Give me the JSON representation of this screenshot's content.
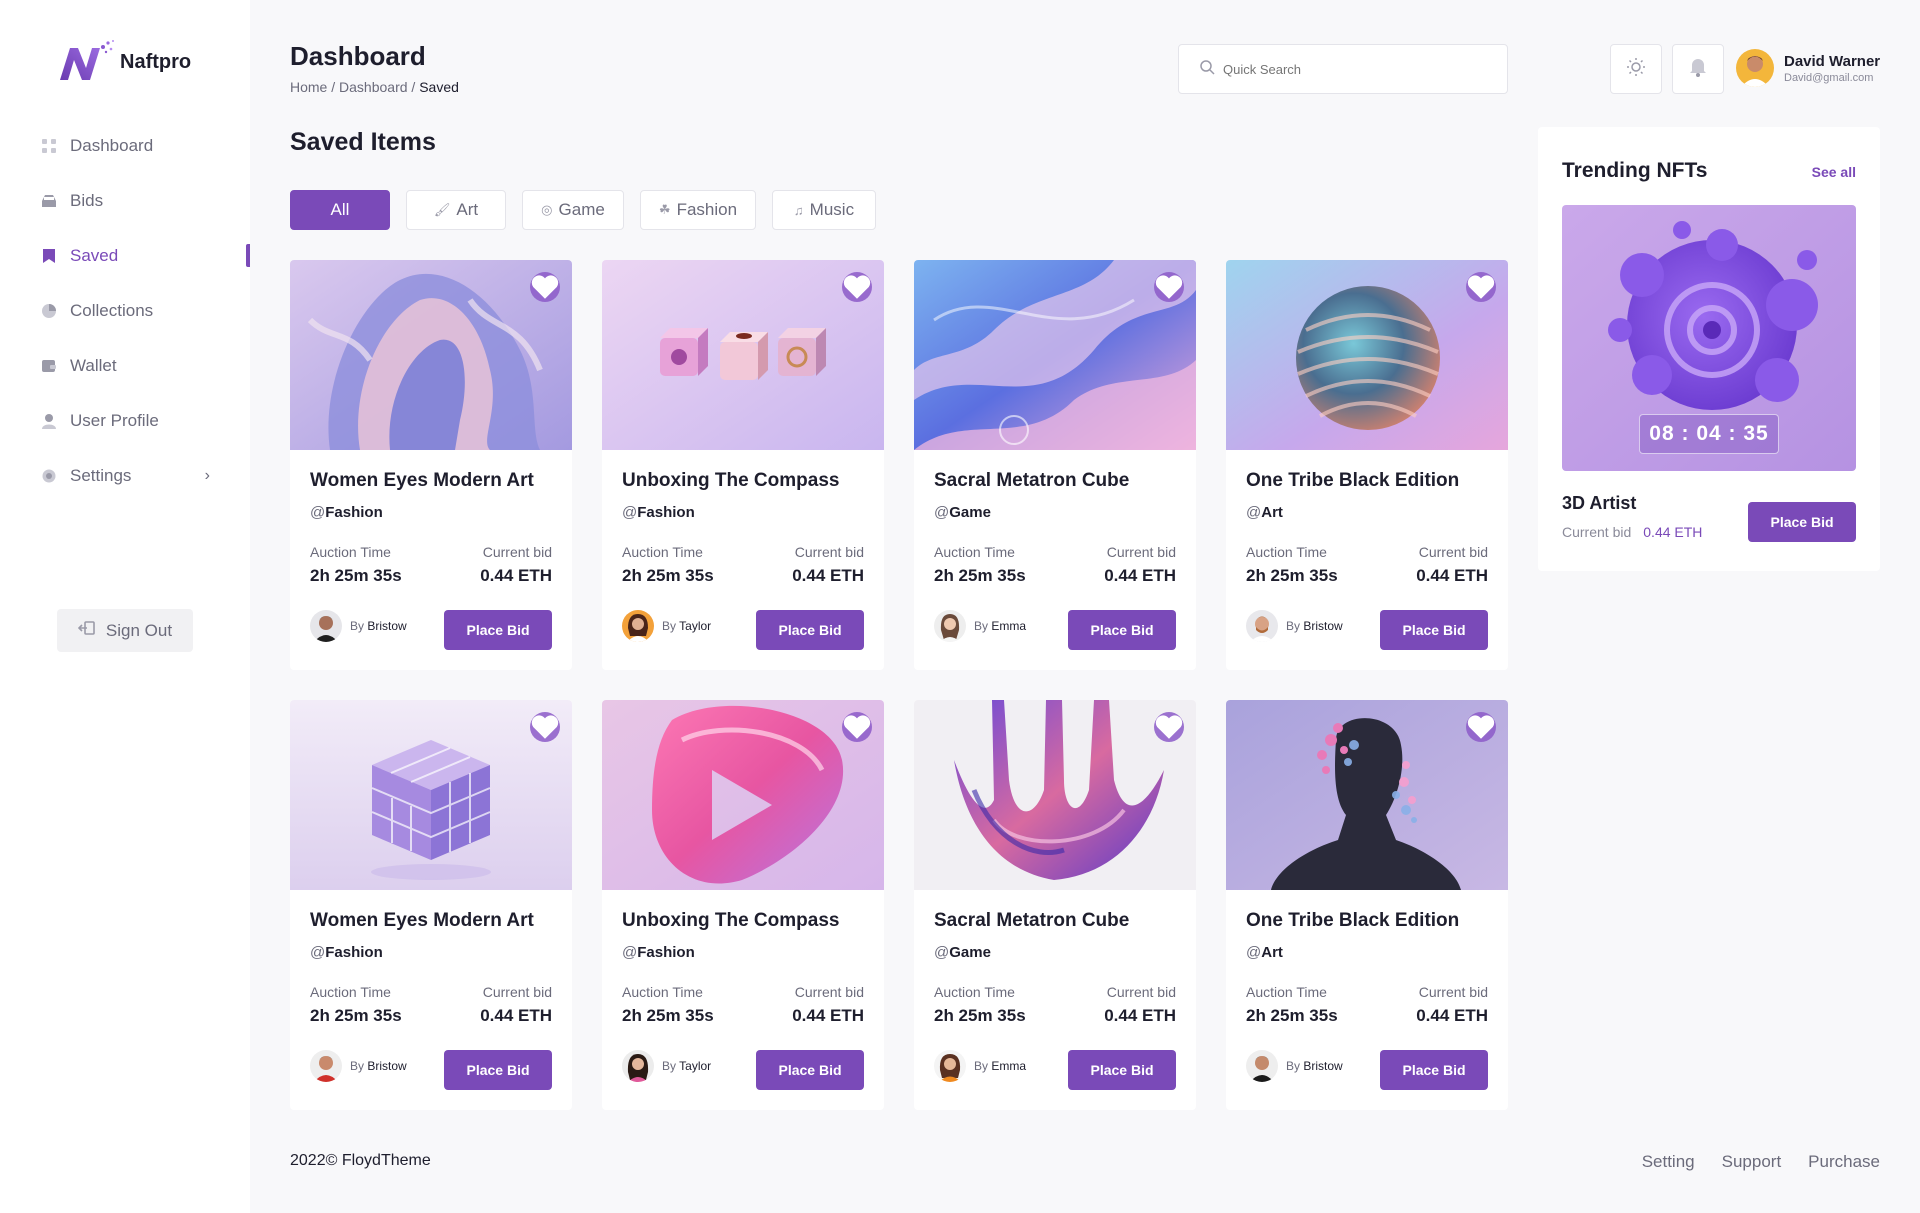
{
  "brand": {
    "name": "Naftpro",
    "accent": "#7a4ab8"
  },
  "sidebar": {
    "items": [
      {
        "label": "Dashboard",
        "icon": "grid-icon"
      },
      {
        "label": "Bids",
        "icon": "inbox-icon"
      },
      {
        "label": "Saved",
        "icon": "bookmark-icon",
        "active": true
      },
      {
        "label": "Collections",
        "icon": "pie-icon"
      },
      {
        "label": "Wallet",
        "icon": "wallet-icon"
      },
      {
        "label": "User Profile",
        "icon": "user-icon"
      },
      {
        "label": "Settings",
        "icon": "gear-icon",
        "chevron": "›"
      }
    ],
    "sign_out": "Sign Out"
  },
  "header": {
    "title": "Dashboard",
    "breadcrumb": {
      "home": "Home",
      "sep": " / ",
      "parent": "Dashboard",
      "current": "Saved"
    },
    "search_placeholder": "Quick Search",
    "user": {
      "name": "David Warner",
      "email": "David@gmail.com"
    }
  },
  "main": {
    "section_title": "Saved Items",
    "filters": [
      {
        "label": "All",
        "icon": ""
      },
      {
        "label": "Art",
        "icon": "brush-icon"
      },
      {
        "label": "Game",
        "icon": "target-icon"
      },
      {
        "label": "Fashion",
        "icon": "hanger-icon"
      },
      {
        "label": "Music",
        "icon": "music-note-icon"
      }
    ],
    "auction_label": "Auction Time",
    "bid_label": "Current bid",
    "by_label": "By",
    "button_label": "Place Bid",
    "cards": [
      {
        "title": "Women Eyes Modern Art",
        "category": "Fashion",
        "time": "2h 25m 35s",
        "bid": "0.44 ETH",
        "author": "Bristow"
      },
      {
        "title": "Unboxing The Compass",
        "category": "Fashion",
        "time": "2h 25m 35s",
        "bid": "0.44 ETH",
        "author": "Taylor"
      },
      {
        "title": "Sacral Metatron Cube",
        "category": "Game",
        "time": "2h 25m 35s",
        "bid": "0.44 ETH",
        "author": "Emma"
      },
      {
        "title": "One Tribe Black Edition",
        "category": "Art",
        "time": "2h 25m 35s",
        "bid": "0.44 ETH",
        "author": "Bristow"
      },
      {
        "title": "Women Eyes Modern Art",
        "category": "Fashion",
        "time": "2h 25m 35s",
        "bid": "0.44 ETH",
        "author": "Bristow"
      },
      {
        "title": "Unboxing The Compass",
        "category": "Fashion",
        "time": "2h 25m 35s",
        "bid": "0.44 ETH",
        "author": "Taylor"
      },
      {
        "title": "Sacral Metatron Cube",
        "category": "Game",
        "time": "2h 25m 35s",
        "bid": "0.44 ETH",
        "author": "Emma"
      },
      {
        "title": "One Tribe Black Edition",
        "category": "Art",
        "time": "2h 25m 35s",
        "bid": "0.44 ETH",
        "author": "Bristow"
      }
    ]
  },
  "trending": {
    "title": "Trending NFTs",
    "see_all": "See all",
    "timer": "08 : 04 : 35",
    "name": "3D Artist",
    "bid_label": "Current bid",
    "bid_value": "0.44 ETH",
    "button": "Place Bid"
  },
  "footer": {
    "copyright": "2022© FloydTheme",
    "links": [
      "Setting",
      "Support",
      "Purchase"
    ]
  }
}
